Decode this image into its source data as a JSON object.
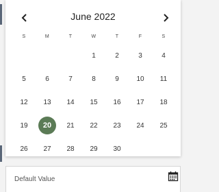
{
  "calendar": {
    "month_title": "June 2022",
    "prev_icon": "chevron-left-icon",
    "next_icon": "chevron-right-icon",
    "weekdays": [
      "S",
      "M",
      "T",
      "W",
      "T",
      "F",
      "S"
    ],
    "leading_blank_days": 3,
    "days": [
      "1",
      "2",
      "3",
      "4",
      "5",
      "6",
      "7",
      "8",
      "9",
      "10",
      "11",
      "12",
      "13",
      "14",
      "15",
      "16",
      "17",
      "18",
      "19",
      "20",
      "21",
      "22",
      "23",
      "24",
      "25",
      "26",
      "27",
      "28",
      "29",
      "30"
    ],
    "selected_day": "20",
    "accent_color": "#5b7b56"
  },
  "date_field": {
    "placeholder": "Default Value",
    "icon": "calendar-icon"
  }
}
